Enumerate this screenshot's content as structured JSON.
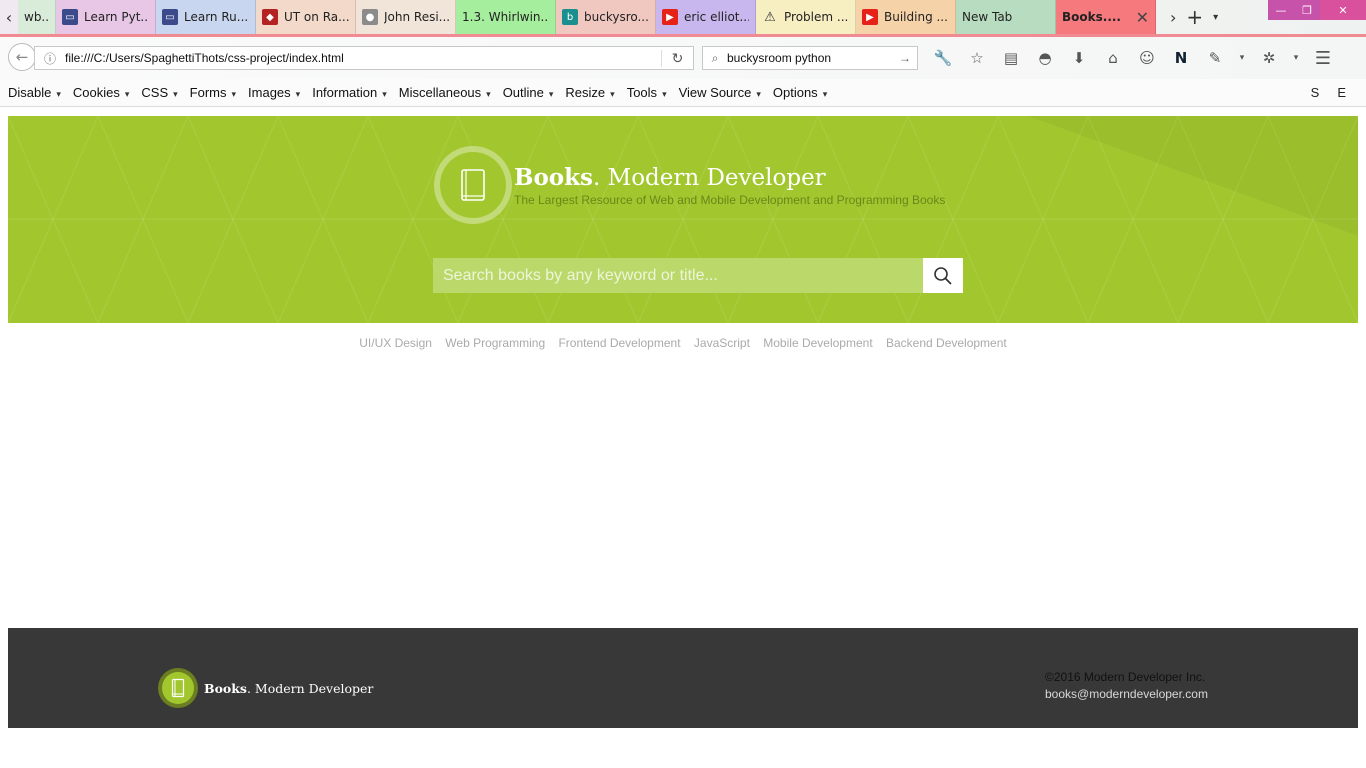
{
  "browser": {
    "tabs": [
      {
        "label": "wb...",
        "icon": "page-icon",
        "color": "#3a7bd5"
      },
      {
        "label": "Learn Pyt...",
        "icon": "monitor-icon",
        "color": "#3b4a8a"
      },
      {
        "label": "Learn Ru...",
        "icon": "monitor-icon",
        "color": "#3b4a8a"
      },
      {
        "label": "UT on Ra...",
        "icon": "ruby-icon",
        "color": "#b52222"
      },
      {
        "label": "John Resi...",
        "icon": "avatar-icon",
        "color": "#777777"
      },
      {
        "label": "1.3. Whirlwin...",
        "icon": "",
        "color": ""
      },
      {
        "label": "buckysro...",
        "icon": "bing-icon",
        "color": "#1a8f8f"
      },
      {
        "label": "eric elliot...",
        "icon": "youtube-icon",
        "color": "#e62117"
      },
      {
        "label": "Problem ...",
        "icon": "warning-icon",
        "color": "#e8b400"
      },
      {
        "label": "Building ...",
        "icon": "youtube-icon",
        "color": "#e62117"
      },
      {
        "label": "New Tab",
        "icon": "",
        "color": ""
      },
      {
        "label": "Books....",
        "icon": "",
        "color": "",
        "active": true
      }
    ],
    "tab_close_glyph": "✕",
    "url": "file:///C:/Users/SpaghettiThots/css-project/index.html",
    "search_value": "buckysroom python",
    "devbar_menus": [
      "Disable",
      "Cookies",
      "CSS",
      "Forms",
      "Images",
      "Information",
      "Miscellaneous",
      "Outline",
      "Resize",
      "Tools",
      "View Source",
      "Options"
    ],
    "devbar_right": [
      "S",
      "E"
    ]
  },
  "page": {
    "brand_bold": "Books",
    "brand_rest": ". Modern Developer",
    "tagline": "The Largest Resource of Web and Mobile Development and Programming Books",
    "search_placeholder": "Search books by any keyword or title...",
    "categories": [
      "UI/UX Design",
      "Web Programming",
      "Frontend Development",
      "JavaScript",
      "Mobile Development",
      "Backend Development"
    ],
    "footer": {
      "brand_bold": "Books",
      "brand_rest": ". Modern Developer",
      "copyright": "©2016 Modern Developer Inc.",
      "email": "books@moderndeveloper.com"
    },
    "colors": {
      "hero": "#a2c72e",
      "footer": "#383838",
      "active_tab": "#f6797e"
    }
  }
}
